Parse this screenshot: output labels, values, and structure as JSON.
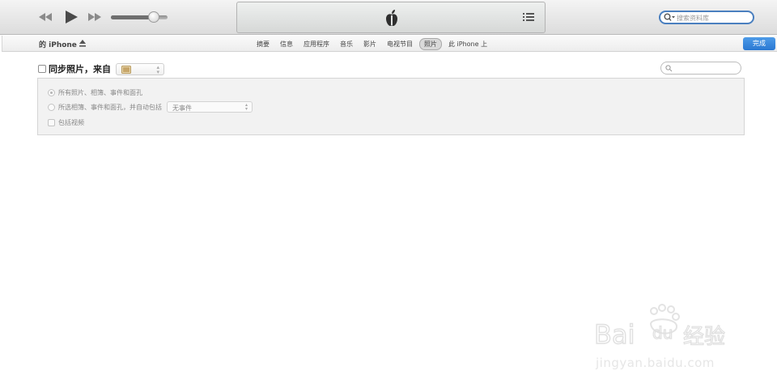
{
  "toolbar": {
    "volume_level": 0.75,
    "search_placeholder": "搜索资料库"
  },
  "device": {
    "name": "的 iPhone"
  },
  "tabs": [
    {
      "label": "摘要",
      "active": false
    },
    {
      "label": "信息",
      "active": false
    },
    {
      "label": "应用程序",
      "active": false
    },
    {
      "label": "音乐",
      "active": false
    },
    {
      "label": "影片",
      "active": false
    },
    {
      "label": "电视节目",
      "active": false
    },
    {
      "label": "照片",
      "active": true
    },
    {
      "label": "此 iPhone 上",
      "active": false
    }
  ],
  "done_label": "完成",
  "sync": {
    "label": "同步照片，来自",
    "checked": false
  },
  "options": {
    "all_photos": "所有照片、相簿、事件和面孔",
    "selected_photos": "所选相簿、事件和面孔，并自动包括",
    "auto_include_value": "无事件",
    "include_videos": "包括视频"
  },
  "watermark": {
    "url_text": "jingyan.baidu.com"
  },
  "colors": {
    "accent_blue": "#2a78d2",
    "search_border": "#4a7fbf"
  }
}
